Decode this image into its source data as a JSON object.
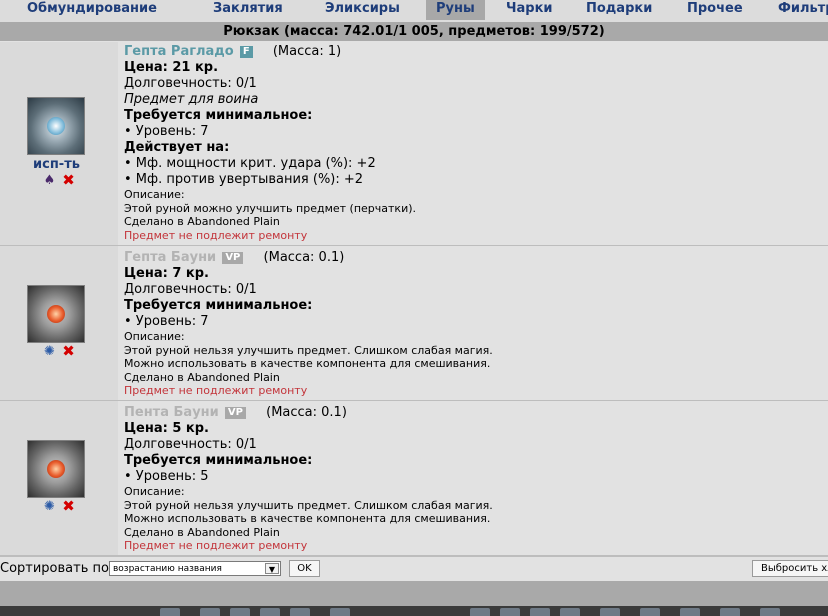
{
  "tabs": [
    {
      "label": "Обмундирование",
      "active": false
    },
    {
      "label": "Заклятия",
      "active": false
    },
    {
      "label": "Эликсиры",
      "active": false
    },
    {
      "label": "Руны",
      "active": true
    },
    {
      "label": "Чарки",
      "active": false
    },
    {
      "label": "Подарки",
      "active": false
    },
    {
      "label": "Прочее",
      "active": false
    },
    {
      "label": "Фильтр",
      "active": false
    }
  ],
  "header": "Рюкзак (масса: 742.01/1 005, предметов: 199/572)",
  "items": [
    {
      "name": "Гепта Рагладо",
      "badge": "F",
      "mass": "(Масса: 1)",
      "price": "Цена: 21 кр.",
      "durability": "Долговечность: 0/1",
      "for_class": "Предмет для воина",
      "req_title": "Требуется минимальное:",
      "req_level": "• Уровень: 7",
      "acts_title": "Действует на:",
      "acts": [
        "• Мф. мощности крит. удара (%): +2",
        "• Мф. против увертывания (%): +2"
      ],
      "desc_title": "Описание:",
      "desc": [
        "Этой руной можно улучшить предмет (перчатки)."
      ],
      "made_in": "Сделано в Abandoned Plain",
      "no_repair": "Предмет не подлежит ремонту",
      "use_label": "исп-ть"
    },
    {
      "name": "Гепта Бауни",
      "badge": "VP",
      "mass": "(Масса: 0.1)",
      "price": "Цена: 7 кр.",
      "durability": "Долговечность: 0/1",
      "req_title": "Требуется минимальное:",
      "req_level": "• Уровень: 7",
      "desc_title": "Описание:",
      "desc": [
        "Этой руной нельзя улучшить предмет. Слишком слабая магия.",
        "Можно использовать в качестве компонента для смешивания."
      ],
      "made_in": "Сделано в Abandoned Plain",
      "no_repair": "Предмет не подлежит ремонту"
    },
    {
      "name": "Пента Бауни",
      "badge": "VP",
      "mass": "(Масса: 0.1)",
      "price": "Цена: 5 кр.",
      "durability": "Долговечность: 0/1",
      "req_title": "Требуется минимальное:",
      "req_level": "• Уровень: 5",
      "desc_title": "Описание:",
      "desc": [
        "Этой руной нельзя улучшить предмет. Слишком слабая магия.",
        "Можно использовать в качестве компонента для смешивания."
      ],
      "made_in": "Сделано в Abandoned Plain",
      "no_repair": "Предмет не подлежит ремонту"
    }
  ],
  "sort": {
    "label": "Сортировать по",
    "selected": "возрастанию названия",
    "ok": "OK",
    "throw": "Выбросить хла"
  },
  "icons": {
    "wear": "wear-icon",
    "delete": "delete-icon",
    "dismantle": "dismantle-icon"
  },
  "colors": {
    "tab_text": "#1e3d7a",
    "item_name_f": "#5b9aa6",
    "item_name_vp": "#b3b3b3",
    "no_repair": "#c3343a",
    "delete": "#d40000"
  }
}
